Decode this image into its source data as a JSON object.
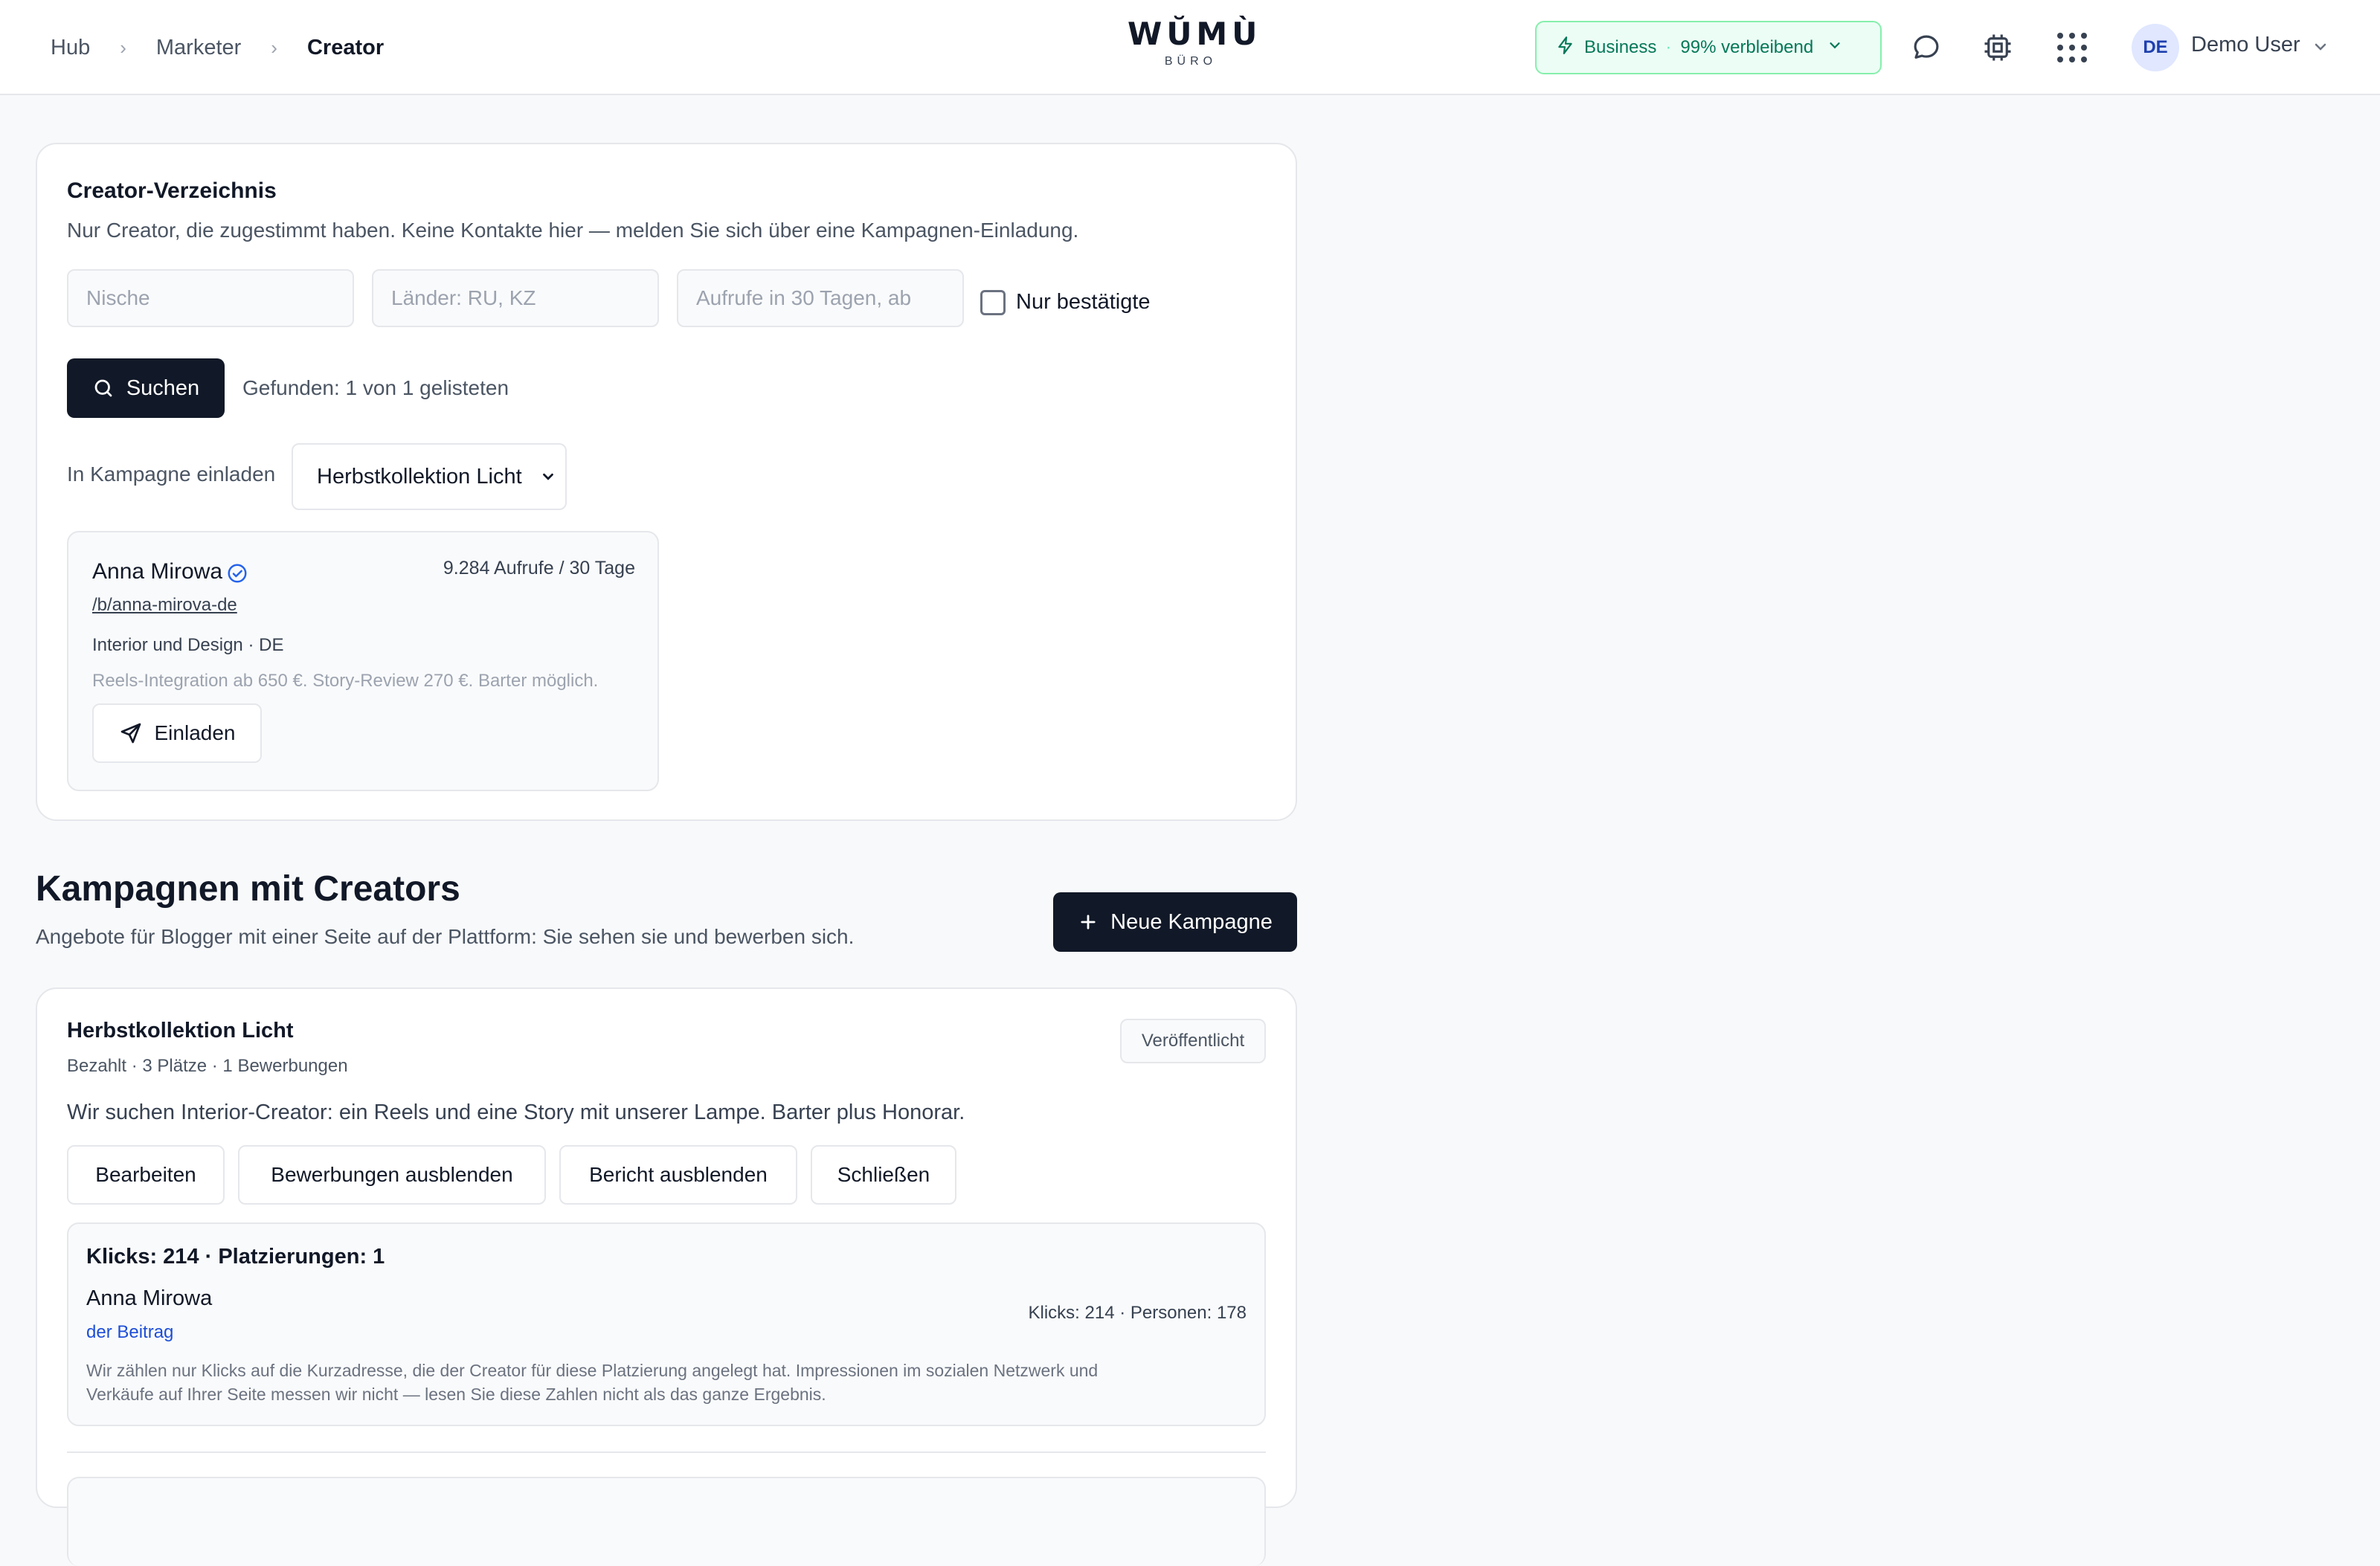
{
  "header": {
    "breadcrumbs": [
      "Hub",
      "Marketer",
      "Creator"
    ],
    "logo_main": "WŬMÙ",
    "logo_sub": "BÜRO",
    "plan_name": "Business",
    "plan_separator": "·",
    "plan_remaining": "99% verbleibend",
    "user_initials": "DE",
    "user_name": "Demo User"
  },
  "directory": {
    "title": "Creator-Verzeichnis",
    "subtitle": "Nur Creator, die zugestimmt haben. Keine Kontakte hier — melden Sie sich über eine Kampagnen-Einladung.",
    "niche_placeholder": "Nische",
    "countries_placeholder": "Länder: RU, KZ",
    "views_placeholder": "Aufrufe in 30 Tagen, ab",
    "verified_only_label": "Nur bestätigte",
    "search_button": "Suchen",
    "found_text": "Gefunden: 1 von 1 gelisteten",
    "invite_label": "In Kampagne einladen",
    "campaign_selected": "Herbstkollektion Licht",
    "creator": {
      "name": "Anna Mirowa",
      "views": "9.284 Aufrufe / 30 Tage",
      "handle": "/b/anna-mirova-de",
      "meta": "Interior und Design · DE",
      "pricing": "Reels-Integration ab 650 €. Story-Review 270 €. Barter möglich.",
      "invite_button": "Einladen"
    }
  },
  "campaigns": {
    "title": "Kampagnen mit Creators",
    "subtitle": "Angebote für Blogger mit einer Seite auf der Plattform: Sie sehen sie und bewerben sich.",
    "new_button": "Neue Kampagne",
    "campaign": {
      "name": "Herbstkollektion Licht",
      "meta": "Bezahlt · 3 Plätze · 1 Bewerbungen",
      "status": "Veröffentlicht",
      "description": "Wir suchen Interior-Creator: ein Reels und eine Story mit unserer Lampe. Barter plus Honorar.",
      "actions": {
        "edit": "Bearbeiten",
        "hide_applications": "Bewerbungen ausblenden",
        "hide_report": "Bericht ausblenden",
        "close": "Schließen"
      },
      "report": {
        "summary": "Klicks: 214 · Platzierungen: 1",
        "creator_name": "Anna Mirowa",
        "post_link": "der Beitrag",
        "creator_stats": "Klicks: 214 · Personen: 178",
        "note_line1": "Wir zählen nur Klicks auf die Kurzadresse, die der Creator für diese Platzierung angelegt hat. Impressionen im sozialen Netzwerk und",
        "note_line2": "Verkäufe auf Ihrer Seite messen wir nicht — lesen Sie diese Zahlen nicht als das ganze Ergebnis."
      }
    }
  },
  "colors": {
    "accent_dark": "#111827",
    "plan_green": "#047857",
    "verified_blue": "#2563eb"
  }
}
